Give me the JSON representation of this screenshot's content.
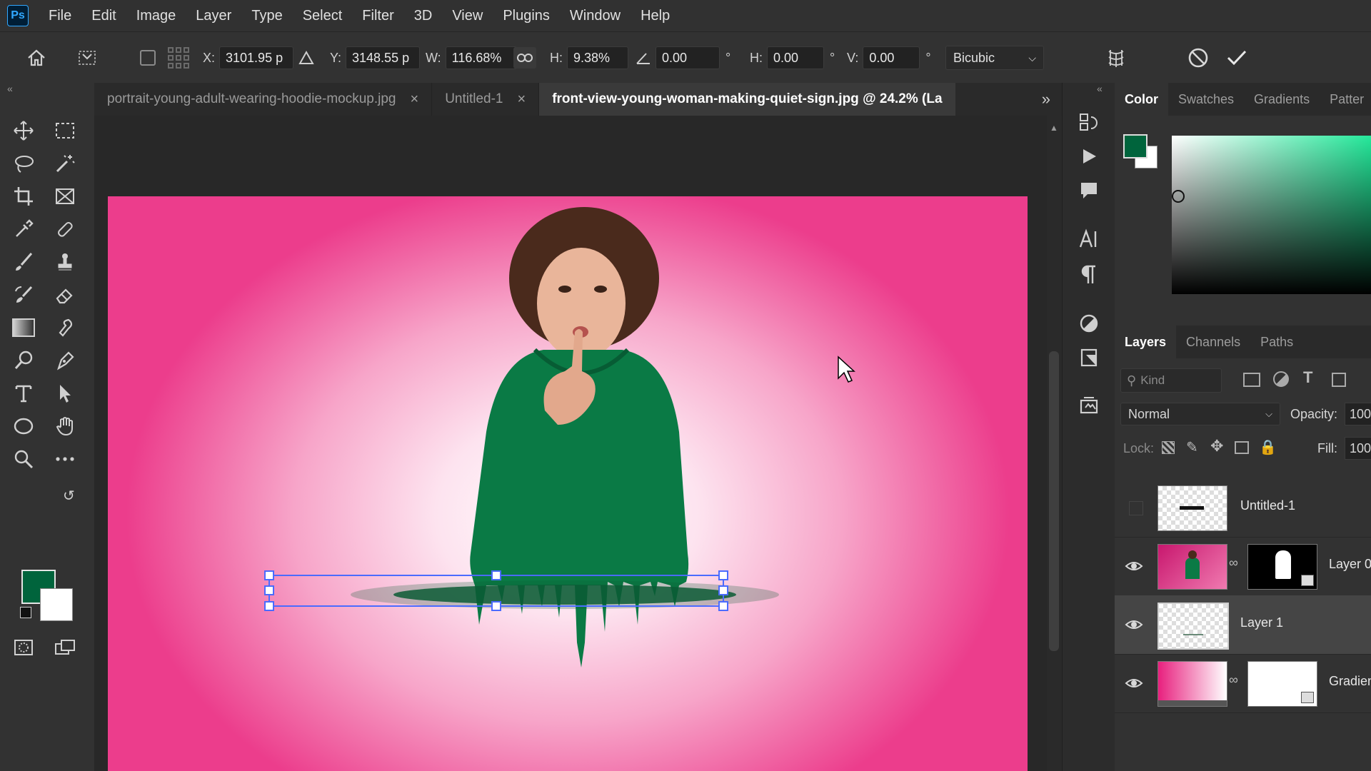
{
  "app": {
    "logo": "Ps"
  },
  "menu": [
    "File",
    "Edit",
    "Image",
    "Layer",
    "Type",
    "Select",
    "Filter",
    "3D",
    "View",
    "Plugins",
    "Window",
    "Help"
  ],
  "options": {
    "x_label": "X:",
    "x_value": "3101.95 p",
    "y_label": "Y:",
    "y_value": "3148.55 p",
    "w_label": "W:",
    "w_value": "116.68%",
    "h_label": "H:",
    "h_value": "9.38%",
    "angle_value": "0.00",
    "degree": "°",
    "hskew_label": "H:",
    "hskew_value": "0.00",
    "vskew_label": "V:",
    "vskew_value": "0.00",
    "interpolation": "Bicubic"
  },
  "tabs": [
    {
      "label": "portrait-young-adult-wearing-hoodie-mockup.jpg",
      "close": "×"
    },
    {
      "label": "Untitled-1",
      "close": "×"
    },
    {
      "label": "front-view-young-woman-making-quiet-sign.jpg @ 24.2% (La"
    }
  ],
  "colors": {
    "foreground": "#00643c",
    "background": "#ffffff",
    "accent_pink": "#ec3d8c",
    "hoodie_green": "#0a7a45"
  },
  "color_panel": {
    "tabs": [
      "Color",
      "Swatches",
      "Gradients",
      "Patter"
    ]
  },
  "layers_panel": {
    "tabs": [
      "Layers",
      "Channels",
      "Paths"
    ],
    "kind_placeholder": "Kind",
    "blend_mode": "Normal",
    "opacity_label": "Opacity:",
    "opacity_value": "100",
    "lock_label": "Lock:",
    "fill_label": "Fill:",
    "fill_value": "100",
    "layers": [
      {
        "name": "Untitled-1",
        "visible": false
      },
      {
        "name": "Layer 0",
        "visible": true
      },
      {
        "name": "Layer 1",
        "visible": true,
        "selected": true
      },
      {
        "name": "Gradien",
        "visible": true
      }
    ]
  },
  "icons": {
    "home": "home-icon",
    "move": "move-tool-icon",
    "cancel": "cancel-transform-icon",
    "commit": "commit-transform-icon",
    "warp": "warp-icon"
  }
}
